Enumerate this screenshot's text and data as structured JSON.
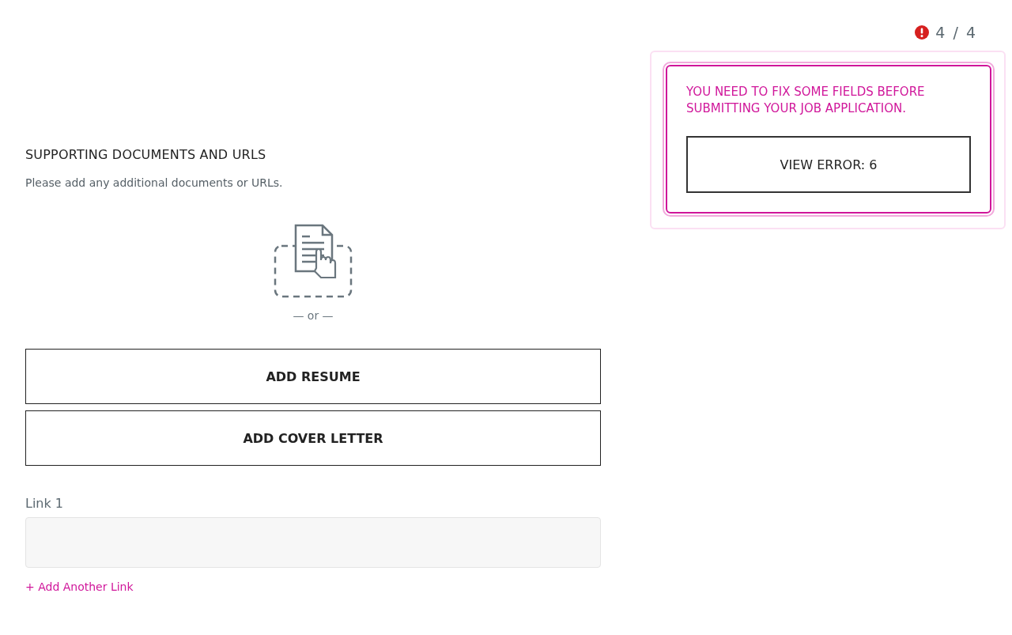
{
  "counter": {
    "text": "4 / 4"
  },
  "section": {
    "title": "SUPPORTING DOCUMENTS AND URLS",
    "description": "Please add any additional documents or URLs.",
    "divider": "— or —",
    "buttons": [
      "ADD RESUME",
      "ADD COVER LETTER"
    ],
    "links": [
      {
        "label": "Link 1"
      }
    ],
    "add_link": "+ Add Another Link"
  },
  "error_popup": {
    "message": "YOU NEED TO FIX SOME FIELDS BEFORE SUBMITTING YOUR JOB APPLICATION.",
    "button": "VIEW ERROR: 6"
  }
}
